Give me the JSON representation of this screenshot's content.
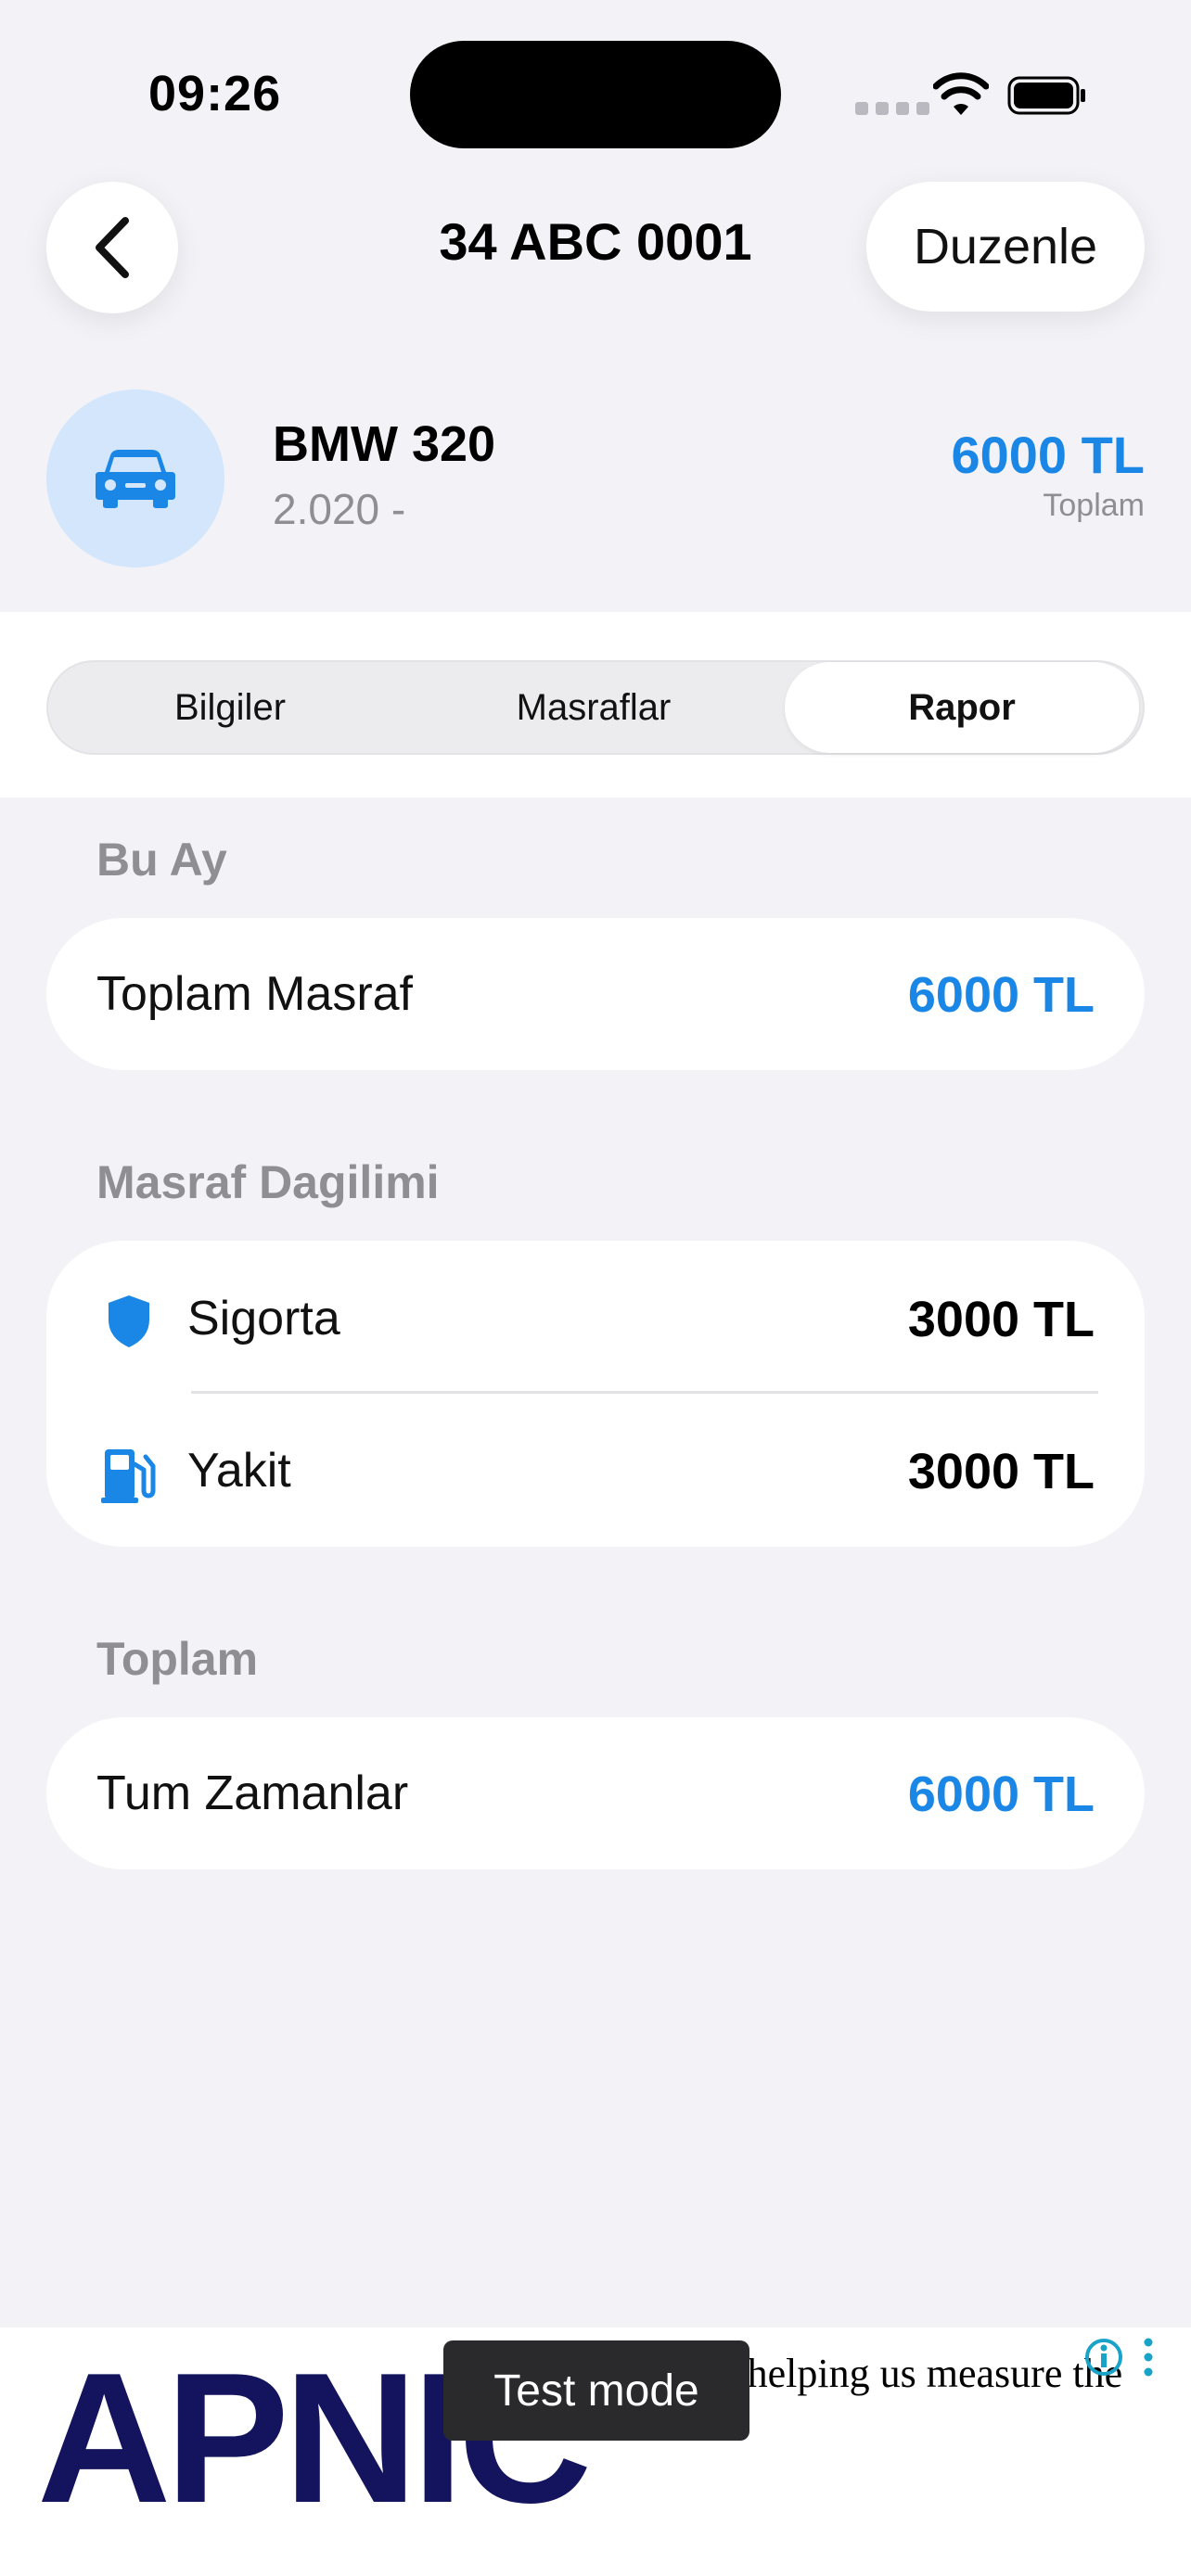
{
  "status_bar": {
    "time": "09:26"
  },
  "nav": {
    "title": "34 ABC 0001",
    "edit_label": "Duzenle"
  },
  "vehicle": {
    "name": "BMW 320",
    "year": "2.020 -",
    "total_amount": "6000 TL",
    "total_label": "Toplam",
    "icon": "car-icon"
  },
  "tabs": [
    {
      "label": "Bilgiler",
      "active": false
    },
    {
      "label": "Masraflar",
      "active": false
    },
    {
      "label": "Rapor",
      "active": true
    }
  ],
  "report": {
    "this_month": {
      "heading": "Bu Ay",
      "label": "Toplam Masraf",
      "value": "6000 TL"
    },
    "distribution": {
      "heading": "Masraf Dagilimi",
      "items": [
        {
          "label": "Sigorta",
          "value": "3000 TL",
          "icon": "shield-icon"
        },
        {
          "label": "Yakit",
          "value": "3000 TL",
          "icon": "fuel-pump-icon"
        }
      ]
    },
    "total": {
      "heading": "Toplam",
      "label": "Tum Zamanlar",
      "value": "6000 TL"
    }
  },
  "ad": {
    "logo_text": "APNIC",
    "body_text": "r helping us measure the",
    "test_mode_label": "Test mode"
  },
  "colors": {
    "accent": "#1a87e6",
    "background": "#f2f2f7",
    "secondary_text": "#8e8e93"
  }
}
